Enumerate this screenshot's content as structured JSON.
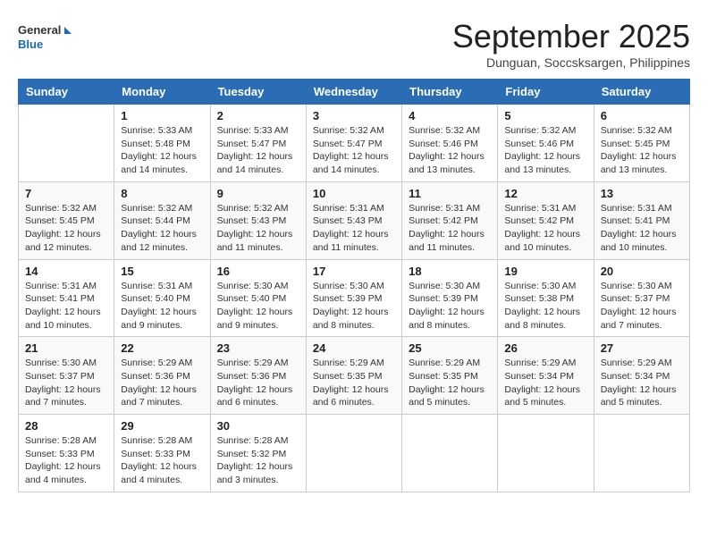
{
  "logo": {
    "text_general": "General",
    "text_blue": "Blue"
  },
  "title": "September 2025",
  "subtitle": "Dunguan, Soccsksargen, Philippines",
  "days_of_week": [
    "Sunday",
    "Monday",
    "Tuesday",
    "Wednesday",
    "Thursday",
    "Friday",
    "Saturday"
  ],
  "weeks": [
    [
      {
        "day": "",
        "info": ""
      },
      {
        "day": "1",
        "info": "Sunrise: 5:33 AM\nSunset: 5:48 PM\nDaylight: 12 hours\nand 14 minutes."
      },
      {
        "day": "2",
        "info": "Sunrise: 5:33 AM\nSunset: 5:47 PM\nDaylight: 12 hours\nand 14 minutes."
      },
      {
        "day": "3",
        "info": "Sunrise: 5:32 AM\nSunset: 5:47 PM\nDaylight: 12 hours\nand 14 minutes."
      },
      {
        "day": "4",
        "info": "Sunrise: 5:32 AM\nSunset: 5:46 PM\nDaylight: 12 hours\nand 13 minutes."
      },
      {
        "day": "5",
        "info": "Sunrise: 5:32 AM\nSunset: 5:46 PM\nDaylight: 12 hours\nand 13 minutes."
      },
      {
        "day": "6",
        "info": "Sunrise: 5:32 AM\nSunset: 5:45 PM\nDaylight: 12 hours\nand 13 minutes."
      }
    ],
    [
      {
        "day": "7",
        "info": "Sunrise: 5:32 AM\nSunset: 5:45 PM\nDaylight: 12 hours\nand 12 minutes."
      },
      {
        "day": "8",
        "info": "Sunrise: 5:32 AM\nSunset: 5:44 PM\nDaylight: 12 hours\nand 12 minutes."
      },
      {
        "day": "9",
        "info": "Sunrise: 5:32 AM\nSunset: 5:43 PM\nDaylight: 12 hours\nand 11 minutes."
      },
      {
        "day": "10",
        "info": "Sunrise: 5:31 AM\nSunset: 5:43 PM\nDaylight: 12 hours\nand 11 minutes."
      },
      {
        "day": "11",
        "info": "Sunrise: 5:31 AM\nSunset: 5:42 PM\nDaylight: 12 hours\nand 11 minutes."
      },
      {
        "day": "12",
        "info": "Sunrise: 5:31 AM\nSunset: 5:42 PM\nDaylight: 12 hours\nand 10 minutes."
      },
      {
        "day": "13",
        "info": "Sunrise: 5:31 AM\nSunset: 5:41 PM\nDaylight: 12 hours\nand 10 minutes."
      }
    ],
    [
      {
        "day": "14",
        "info": "Sunrise: 5:31 AM\nSunset: 5:41 PM\nDaylight: 12 hours\nand 10 minutes."
      },
      {
        "day": "15",
        "info": "Sunrise: 5:31 AM\nSunset: 5:40 PM\nDaylight: 12 hours\nand 9 minutes."
      },
      {
        "day": "16",
        "info": "Sunrise: 5:30 AM\nSunset: 5:40 PM\nDaylight: 12 hours\nand 9 minutes."
      },
      {
        "day": "17",
        "info": "Sunrise: 5:30 AM\nSunset: 5:39 PM\nDaylight: 12 hours\nand 8 minutes."
      },
      {
        "day": "18",
        "info": "Sunrise: 5:30 AM\nSunset: 5:39 PM\nDaylight: 12 hours\nand 8 minutes."
      },
      {
        "day": "19",
        "info": "Sunrise: 5:30 AM\nSunset: 5:38 PM\nDaylight: 12 hours\nand 8 minutes."
      },
      {
        "day": "20",
        "info": "Sunrise: 5:30 AM\nSunset: 5:37 PM\nDaylight: 12 hours\nand 7 minutes."
      }
    ],
    [
      {
        "day": "21",
        "info": "Sunrise: 5:30 AM\nSunset: 5:37 PM\nDaylight: 12 hours\nand 7 minutes."
      },
      {
        "day": "22",
        "info": "Sunrise: 5:29 AM\nSunset: 5:36 PM\nDaylight: 12 hours\nand 7 minutes."
      },
      {
        "day": "23",
        "info": "Sunrise: 5:29 AM\nSunset: 5:36 PM\nDaylight: 12 hours\nand 6 minutes."
      },
      {
        "day": "24",
        "info": "Sunrise: 5:29 AM\nSunset: 5:35 PM\nDaylight: 12 hours\nand 6 minutes."
      },
      {
        "day": "25",
        "info": "Sunrise: 5:29 AM\nSunset: 5:35 PM\nDaylight: 12 hours\nand 5 minutes."
      },
      {
        "day": "26",
        "info": "Sunrise: 5:29 AM\nSunset: 5:34 PM\nDaylight: 12 hours\nand 5 minutes."
      },
      {
        "day": "27",
        "info": "Sunrise: 5:29 AM\nSunset: 5:34 PM\nDaylight: 12 hours\nand 5 minutes."
      }
    ],
    [
      {
        "day": "28",
        "info": "Sunrise: 5:28 AM\nSunset: 5:33 PM\nDaylight: 12 hours\nand 4 minutes."
      },
      {
        "day": "29",
        "info": "Sunrise: 5:28 AM\nSunset: 5:33 PM\nDaylight: 12 hours\nand 4 minutes."
      },
      {
        "day": "30",
        "info": "Sunrise: 5:28 AM\nSunset: 5:32 PM\nDaylight: 12 hours\nand 3 minutes."
      },
      {
        "day": "",
        "info": ""
      },
      {
        "day": "",
        "info": ""
      },
      {
        "day": "",
        "info": ""
      },
      {
        "day": "",
        "info": ""
      }
    ]
  ]
}
